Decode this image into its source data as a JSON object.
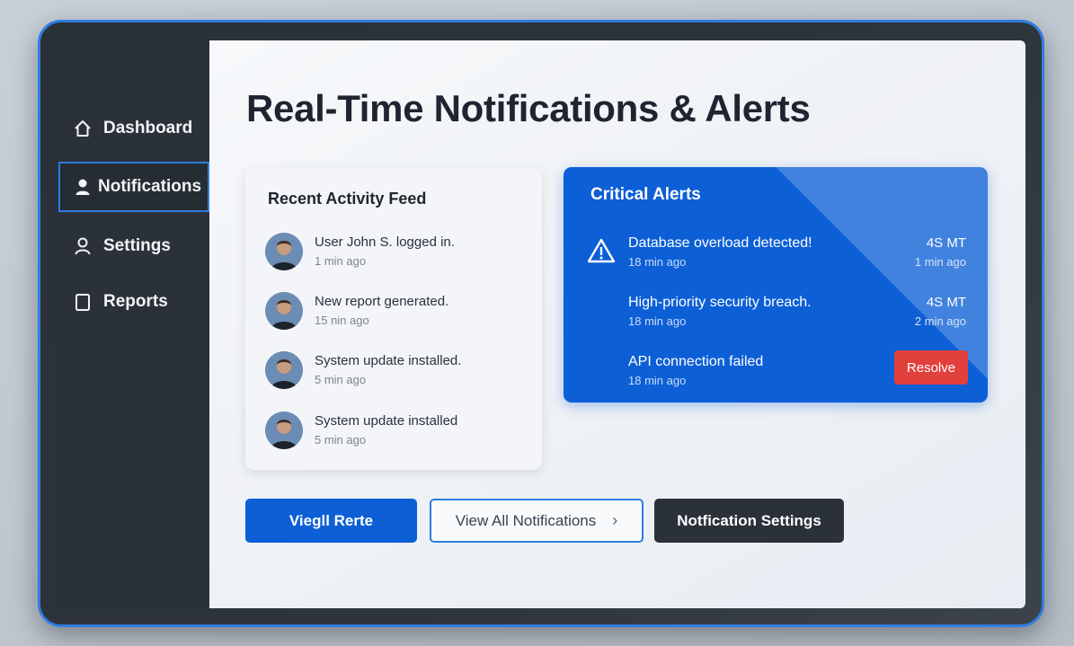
{
  "sidebar": {
    "items": [
      {
        "label": "Dashboard",
        "icon": "home-icon",
        "active": false
      },
      {
        "label": "Notifications",
        "icon": "user-icon",
        "active": true
      },
      {
        "label": "Settings",
        "icon": "person-outline-icon",
        "active": false
      },
      {
        "label": "Reports",
        "icon": "document-icon",
        "active": false
      }
    ]
  },
  "main": {
    "title": "Real-Time Notifications & Alerts"
  },
  "feed": {
    "title": "Recent Activity Feed",
    "items": [
      {
        "text": "User John S. logged in.",
        "time": "1 min ago"
      },
      {
        "text": "New report generated.",
        "time": "15 nin ago"
      },
      {
        "text": "System update installed.",
        "time": "5 min ago"
      },
      {
        "text": "System update installed",
        "time": "5 min ago"
      }
    ]
  },
  "alerts": {
    "title": "Critical Alerts",
    "items": [
      {
        "text": "Database overload detected!",
        "time": "18 min ago",
        "value": "4S MT",
        "age": "1 min ago"
      },
      {
        "text": "High-priority security breach.",
        "time": "18 min ago",
        "value": "4S MT",
        "age": "2 min ago"
      },
      {
        "text": "API connection failed",
        "time": "18 min ago"
      }
    ],
    "resolve_label": "Resolve"
  },
  "actions": {
    "primary_label": "Viegll Rerte",
    "view_all_label": "View All Notifications",
    "settings_label": "Notfication Settings"
  },
  "colors": {
    "accent": "#0d5fd6",
    "danger": "#e2403c",
    "sidebar": "#2b3139"
  }
}
